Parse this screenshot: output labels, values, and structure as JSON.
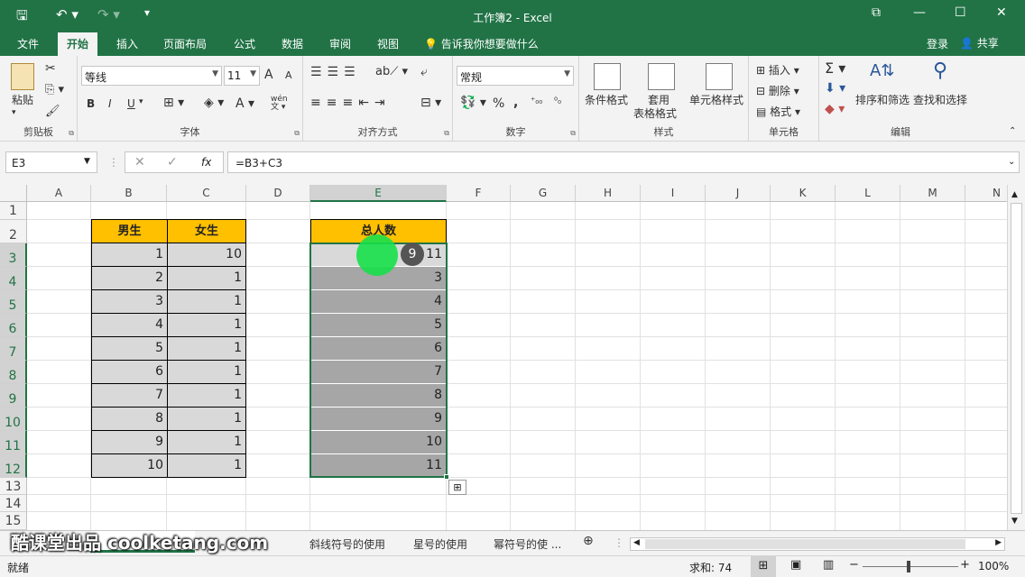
{
  "titlebar": {
    "title": "工作簿2 - Excel",
    "save_icon": "save-icon",
    "undo_icon": "undo-icon",
    "redo_icon": "redo-icon"
  },
  "tabs": [
    "文件",
    "开始",
    "插入",
    "页面布局",
    "公式",
    "数据",
    "审阅",
    "视图"
  ],
  "tellme": "告诉我你想要做什么",
  "login": "登录",
  "share": "共享",
  "ribbon": {
    "clipboard": {
      "label": "剪贴板",
      "paste": "粘贴"
    },
    "font": {
      "label": "字体",
      "name": "等线",
      "size": "11",
      "bold": "B",
      "italic": "I",
      "underline": "U",
      "grow": "A",
      "shrink": "A",
      "fontcolor": "A",
      "wen": "wén"
    },
    "align": {
      "label": "对齐方式"
    },
    "number": {
      "label": "数字",
      "format": "常规",
      "percent": "%",
      "comma": ","
    },
    "styles": {
      "label": "样式",
      "cond": "条件格式",
      "table1": "套用",
      "table2": "表格格式",
      "cell": "单元格样式"
    },
    "cells": {
      "label": "单元格",
      "insert": "插入",
      "delete": "删除",
      "format": "格式"
    },
    "edit": {
      "label": "编辑",
      "sortfilter": "排序和筛选",
      "findselect": "查找和选择"
    }
  },
  "formula": {
    "namebox": "E3",
    "fx": "fx",
    "content": "=B3+C3"
  },
  "columns": [
    "A",
    "B",
    "C",
    "D",
    "E",
    "F",
    "G",
    "H",
    "I",
    "J",
    "K",
    "L",
    "M",
    "N"
  ],
  "rows": [
    "1",
    "2",
    "3",
    "4",
    "5",
    "6",
    "7",
    "8",
    "9",
    "10",
    "11",
    "12",
    "13",
    "14",
    "15"
  ],
  "table": {
    "b_header": "男生",
    "c_header": "女生",
    "e_header": "总人数",
    "b": [
      "1",
      "2",
      "3",
      "4",
      "5",
      "6",
      "7",
      "8",
      "9",
      "10"
    ],
    "c": [
      "10",
      "1",
      "1",
      "1",
      "1",
      "1",
      "1",
      "1",
      "1",
      "1"
    ],
    "e": [
      "11",
      "3",
      "4",
      "5",
      "6",
      "7",
      "8",
      "9",
      "10",
      "11"
    ]
  },
  "badge": "9",
  "sheets": [
    "斜线符号的使用",
    "星号的使用",
    "幂符号的使 ..."
  ],
  "watermark": "酷课堂出品 coolketang.com",
  "status": {
    "ready": "就绪",
    "sum": "求和: 74",
    "zoom": "100%"
  }
}
